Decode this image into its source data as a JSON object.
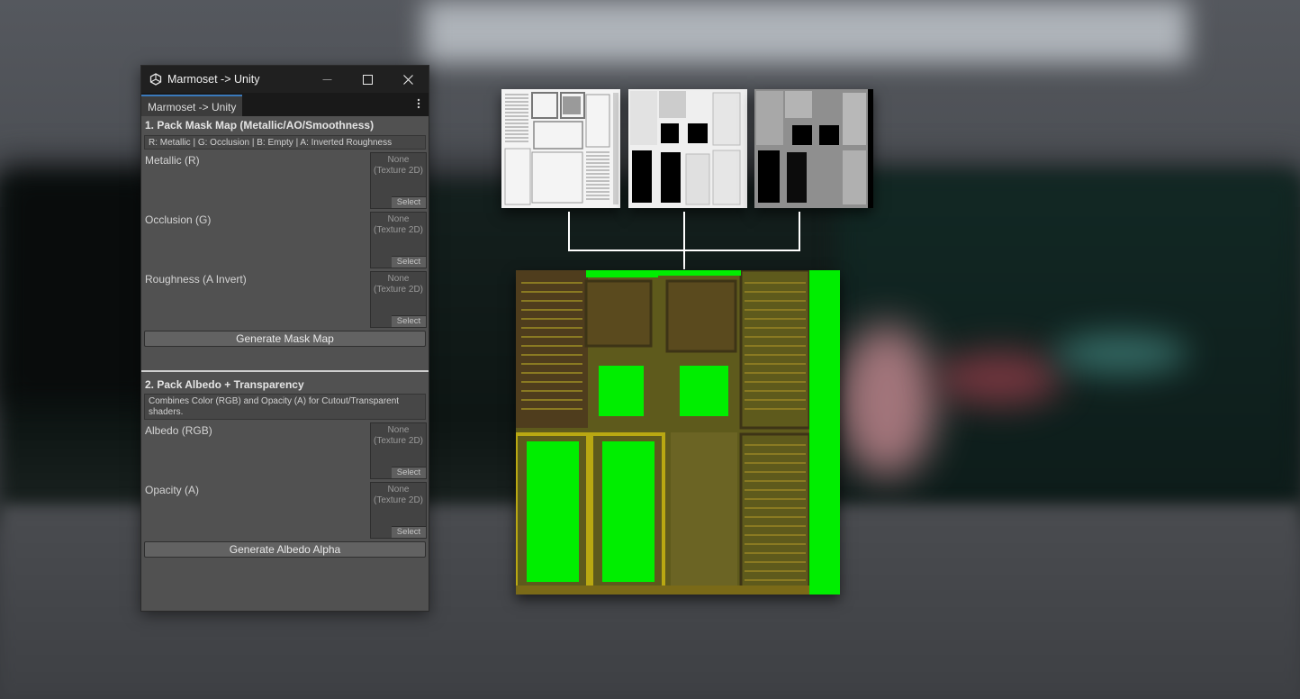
{
  "window": {
    "title": "Marmoset -> Unity",
    "tab_label": "Marmoset -> Unity",
    "icons": {
      "app": "unity-logo-icon",
      "minimize": "minimize-icon",
      "maximize": "maximize-icon",
      "close": "close-icon",
      "menu": "kebab-menu-icon"
    }
  },
  "mask_section": {
    "title": "1. Pack Mask Map (Metallic/AO/Smoothness)",
    "info": "R: Metallic | G: Occlusion | B: Empty | A: Inverted Roughness",
    "fields": [
      {
        "label": "Metallic (R)",
        "slot_value": "None",
        "slot_type": "(Texture 2D)",
        "select_label": "Select"
      },
      {
        "label": "Occlusion (G)",
        "slot_value": "None",
        "slot_type": "(Texture 2D)",
        "select_label": "Select"
      },
      {
        "label": "Roughness (A Invert)",
        "slot_value": "None",
        "slot_type": "(Texture 2D)",
        "select_label": "Select"
      }
    ],
    "button_label": "Generate Mask Map"
  },
  "albedo_section": {
    "title": "2. Pack Albedo + Transparency",
    "info": "Combines Color (RGB) and Opacity (A) for Cutout/Transparent shaders.",
    "fields": [
      {
        "label": "Albedo (RGB)",
        "slot_value": "None",
        "slot_type": "(Texture 2D)",
        "select_label": "Select"
      },
      {
        "label": "Opacity (A)",
        "slot_value": "None",
        "slot_type": "(Texture 2D)",
        "select_label": "Select"
      }
    ],
    "button_label": "Generate Albedo Alpha"
  },
  "diagram": {
    "inputs": [
      "metallic-texture",
      "occlusion-texture",
      "roughness-texture"
    ],
    "output": "packed-mask-texture",
    "colors": {
      "metallic_bg": "#f2f2f2",
      "ao_bg": "#efefef",
      "rough_bg": "#8f8f8f",
      "packed_base": "#5e5a1c",
      "packed_green": "#00ee00"
    }
  }
}
